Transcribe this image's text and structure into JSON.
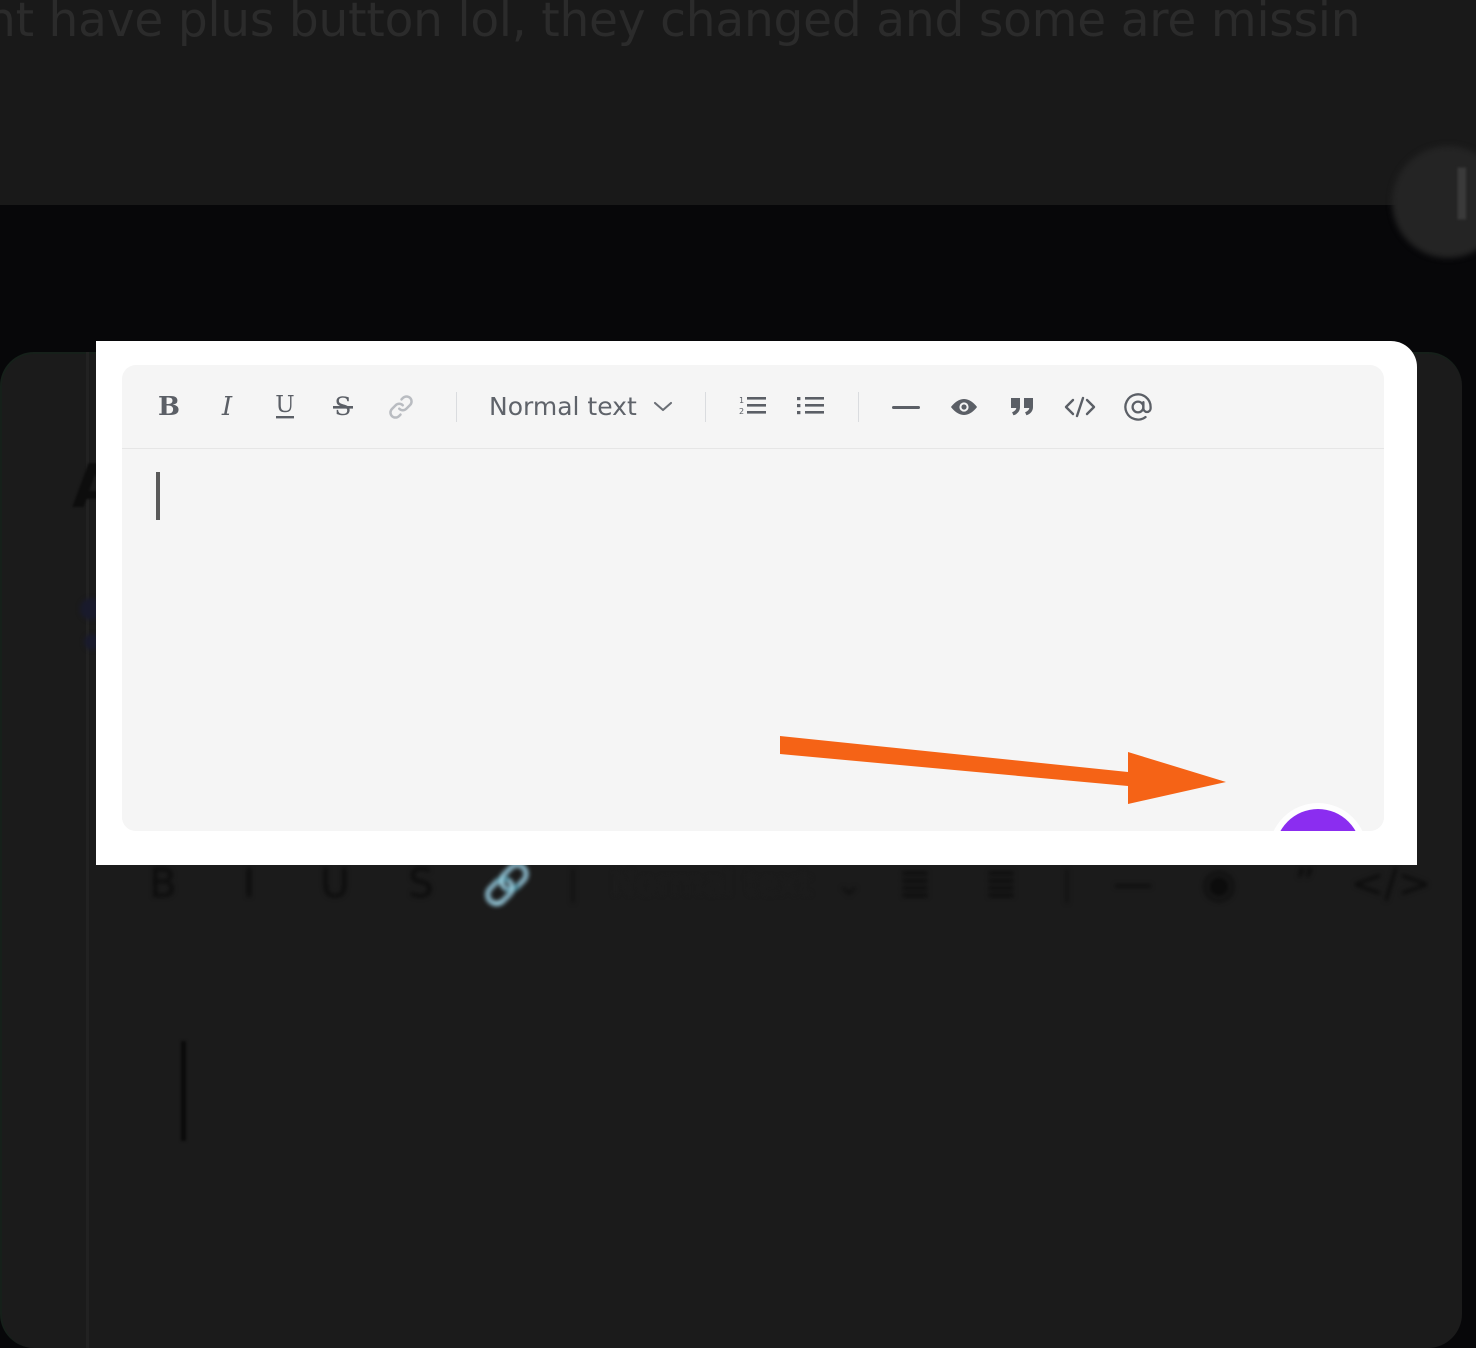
{
  "background": {
    "headline_text": "nt have plus button lol, they changed and some are missin",
    "avatar_glyph": "❙❙",
    "card_letter": "A",
    "dim_color": "#070709",
    "band_color": "#191919",
    "dimmed_toolbar_items": [
      "B",
      "I",
      "U",
      "S",
      "link-icon",
      "|",
      "Normal text",
      "⌄",
      "ordered-list-icon",
      "bullet-list-icon",
      "|",
      "—",
      "eye-icon",
      "quote-icon",
      "</>"
    ]
  },
  "overlay": {
    "panel_background": "#ffffff",
    "editor_background": "#f5f5f5",
    "toolbar": {
      "bold_label": "B",
      "italic_label": "I",
      "underline_label": "U",
      "strikethrough_label": "S",
      "link_label": "link",
      "style_dropdown": {
        "selected": "Normal text",
        "chevron": "⌄"
      },
      "ordered_list_label": "ordered list",
      "bullet_list_label": "bullet list",
      "divider_label": "horizontal rule",
      "spoiler_label": "spoiler",
      "quote_label": "quote",
      "code_label": "code block",
      "mention_label": "mention"
    },
    "editor": {
      "content": "",
      "placeholder": "",
      "caret_visible": "true"
    },
    "add_button": {
      "label": "+",
      "color": "#8b2df0",
      "name": "add-attachment-button"
    }
  },
  "annotation": {
    "arrow_color": "#f56316",
    "arrow_direction": "right",
    "points_to": "add-attachment-button"
  }
}
